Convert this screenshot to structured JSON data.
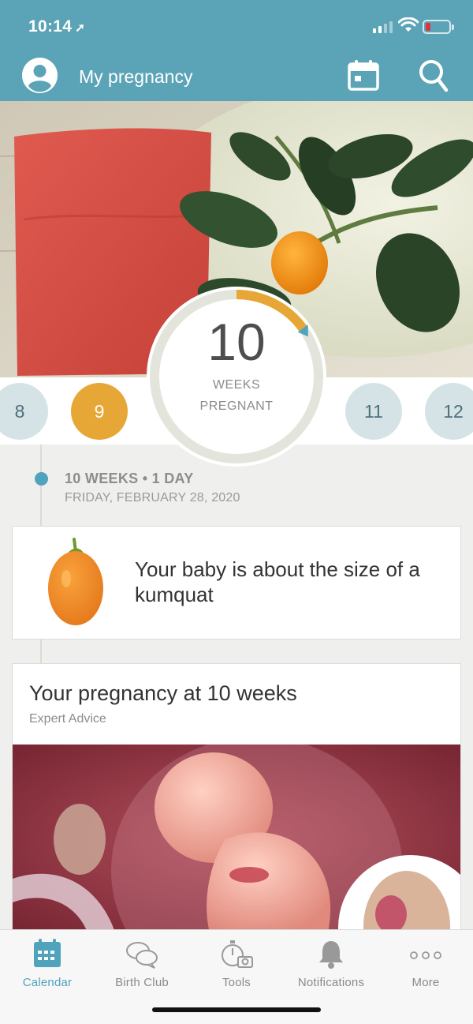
{
  "status_bar": {
    "time": "10:14",
    "location_arrow": "location-arrow-icon",
    "battery_color": "#e1333a"
  },
  "header": {
    "title": "My pregnancy",
    "bg_color": "#5ba4b7"
  },
  "weeks": {
    "items": [
      "8",
      "9",
      "11",
      "12"
    ],
    "current": "10",
    "current_label_1": "WEEKS",
    "current_label_2": "PREGNANT",
    "progress_fraction": 0.15,
    "progress_color": "#e6a736"
  },
  "timeline": {
    "title": "10 WEEKS • 1 DAY",
    "date": "FRIDAY, FEBRUARY 28, 2020"
  },
  "size_card": {
    "text": "Your baby is about the size of a kumquat",
    "icon": "kumquat-icon"
  },
  "advice_card": {
    "title": "Your pregnancy at 10 weeks",
    "subtitle": "Expert Advice"
  },
  "tabs": [
    {
      "label": "Calendar",
      "icon": "calendar-icon",
      "active": true
    },
    {
      "label": "Birth Club",
      "icon": "chat-bubbles-icon",
      "active": false
    },
    {
      "label": "Tools",
      "icon": "tools-icon",
      "active": false
    },
    {
      "label": "Notifications",
      "icon": "bell-icon",
      "active": false
    },
    {
      "label": "More",
      "icon": "more-dots-icon",
      "active": false
    }
  ],
  "colors": {
    "accent": "#4fa3bd",
    "past_week": "#e6a736",
    "future_week": "#d5e3e7"
  }
}
